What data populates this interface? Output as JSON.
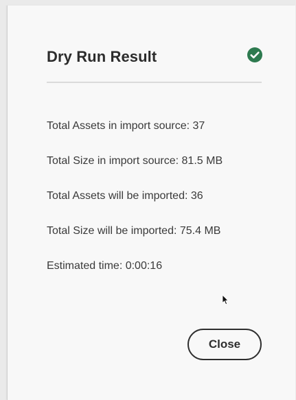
{
  "dialog": {
    "title": "Dry Run Result",
    "status_icon": "check-circle-icon",
    "status_color": "#2d7a4f",
    "lines": [
      {
        "label": "Total Assets in import source: ",
        "value": "37"
      },
      {
        "label": "Total Size in import source: ",
        "value": "81.5 MB"
      },
      {
        "label": "Total Assets will be imported: ",
        "value": "36"
      },
      {
        "label": "Total Size will be imported: ",
        "value": "75.4 MB"
      },
      {
        "label": "Estimated time: ",
        "value": "0:00:16"
      }
    ],
    "close_label": "Close"
  }
}
